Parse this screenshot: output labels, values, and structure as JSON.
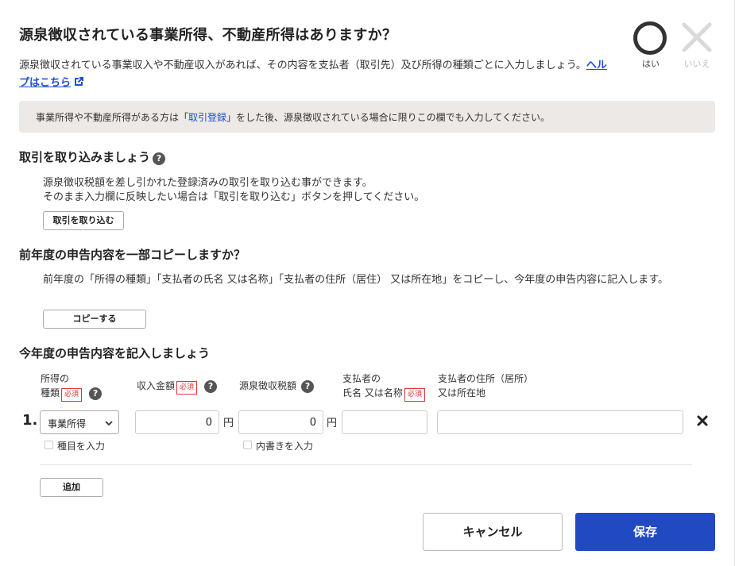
{
  "header": {
    "title": "源泉徴収されている事業所得、不動産所得はありますか？",
    "description": "源泉徴収されている事業収入や不動産収入があれば、その内容を支払者（取引先）及び所得の種類ごとに入力しましょう。",
    "help_link": "ヘルプはこちら",
    "yes_label": "はい",
    "no_label": "いいえ"
  },
  "notice": {
    "prefix": "事業所得や不動産所得がある方は「",
    "link": "取引登録",
    "suffix": "」をした後、源泉徴収されている場合に限りこの欄でも入力してください。"
  },
  "import_section": {
    "heading": "取引を取り込みましょう",
    "line1": "源泉徴収税額を差し引かれた登録済みの取引を取り込む事ができます。",
    "line2": "そのまま入力欄に反映したい場合は「取引を取り込む」ボタンを押してください。",
    "button": "取引を取り込む"
  },
  "copy_section": {
    "heading": "前年度の申告内容を一部コピーしますか？",
    "text": "前年度の「所得の種類」「支払者の氏名 又は名称」「支払者の住所（居住） 又は所在地」をコピーし、今年度の申告内容に記入します。",
    "button": "コピーする"
  },
  "entry_section": {
    "heading": "今年度の申告内容を記入しましょう",
    "required": "必須",
    "columns": {
      "type_line1": "所得の",
      "type_line2": "種類",
      "income": "収入金額",
      "withholding": "源泉徴収税額",
      "payer_name_line1": "支払者の",
      "payer_name_line2": "氏名 又は名称",
      "payer_address_line1": "支払者の住所（居所）",
      "payer_address_line2": "又は所在地"
    },
    "rows": [
      {
        "index": "1.",
        "type": "事業所得",
        "income": "0",
        "withholding": "0",
        "currency": "円",
        "payer_name": "",
        "payer_address": "",
        "type_checkbox_label": "種目を入力",
        "withholding_checkbox_label": "内書きを入力"
      }
    ],
    "add_button": "追加"
  },
  "footer": {
    "cancel": "キャンセル",
    "save": "保存"
  },
  "colors": {
    "primary": "#2149c2",
    "link": "#1a4fd8",
    "required": "#d33333",
    "notice_bg": "#ece9e6"
  }
}
